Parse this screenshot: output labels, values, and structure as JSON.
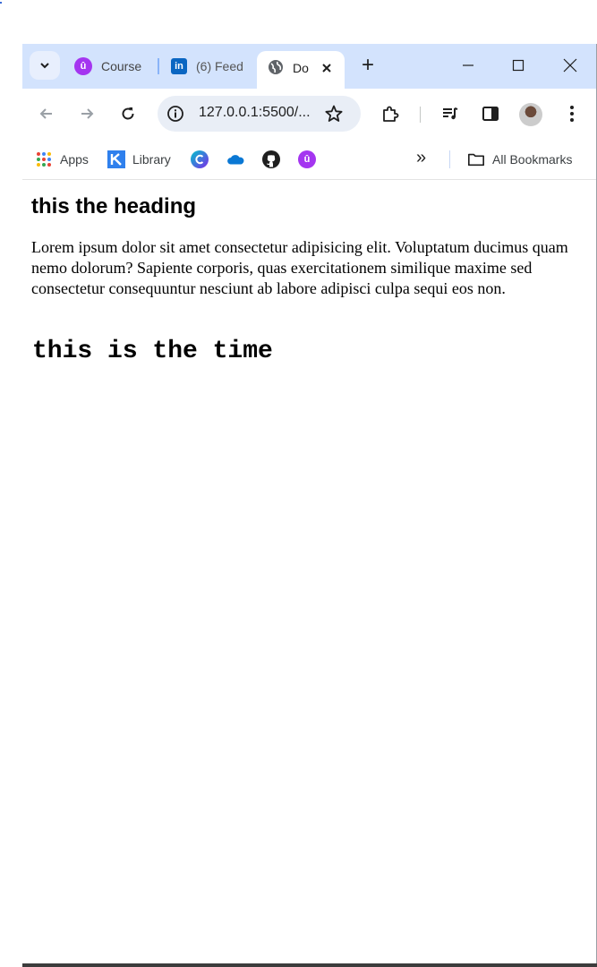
{
  "browser": {
    "tabs": [
      {
        "label": "Course",
        "icon": "udemy-icon"
      },
      {
        "label": "(6) Feed",
        "icon": "linkedin-icon"
      },
      {
        "label": "Do",
        "icon": "globe-icon",
        "active": true
      }
    ],
    "new_tab_label": "+",
    "address": "127.0.0.1:5500/...",
    "bookmarks": [
      {
        "label": "Apps",
        "icon": "apps-grid-icon"
      },
      {
        "label": "Library",
        "icon": "library-icon"
      },
      {
        "label": "",
        "icon": "canva-icon"
      },
      {
        "label": "",
        "icon": "onedrive-icon"
      },
      {
        "label": "",
        "icon": "github-icon"
      },
      {
        "label": "",
        "icon": "udemy-icon"
      }
    ],
    "all_bookmarks_label": "All Bookmarks",
    "overflow_label": "»"
  },
  "page": {
    "heading": "this the heading",
    "paragraph": "Lorem ipsum dolor sit amet consectetur adipisicing elit. Voluptatum ducimus quam nemo dolorum? Sapiente corporis, quas exercitationem similique maxime sed consectetur consequuntur nesciunt ab labore adipisci culpa sequi eos non.",
    "time_text": "this is the time"
  },
  "colors": {
    "tabstrip": "#d3e3fd",
    "udemy": "#a435f0",
    "linkedin": "#0a66c2",
    "omnibox": "#e9eef6"
  }
}
